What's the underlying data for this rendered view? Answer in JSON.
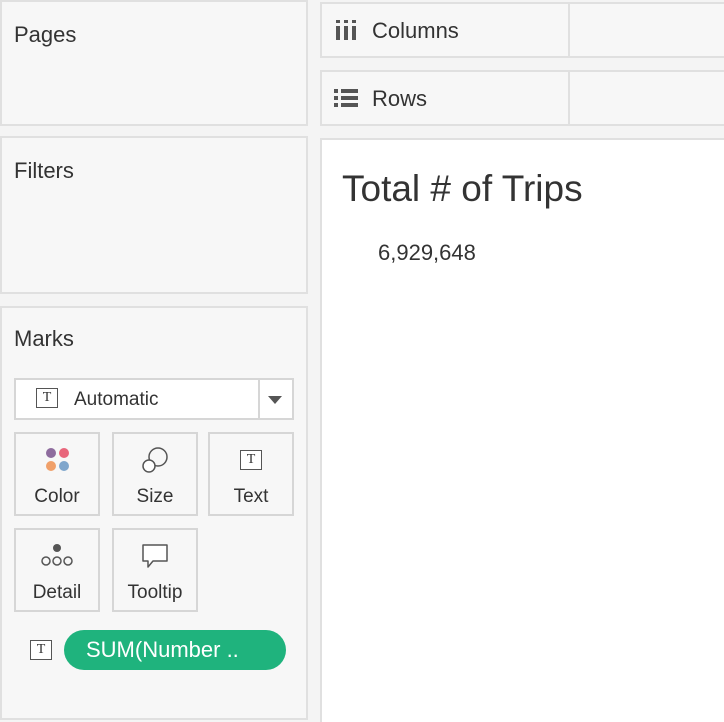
{
  "cards": {
    "pages": {
      "title": "Pages"
    },
    "filters": {
      "title": "Filters"
    },
    "marks": {
      "title": "Marks",
      "mark_type": "Automatic",
      "buttons": {
        "color": "Color",
        "size": "Size",
        "text": "Text",
        "detail": "Detail",
        "tooltip": "Tooltip"
      },
      "pill": {
        "label": "SUM(Number ..",
        "color": "#1fb37d"
      }
    }
  },
  "shelves": {
    "columns": {
      "label": "Columns",
      "icon": "columns-icon"
    },
    "rows": {
      "label": "Rows",
      "icon": "rows-icon"
    }
  },
  "view": {
    "title": "Total # of Trips",
    "value": "6,929,648"
  },
  "icons": {
    "text_glyph": "T"
  },
  "colors": {
    "pill": "#1fb37d",
    "color_dots": [
      "#8e6c9e",
      "#e8667b",
      "#f0a06a",
      "#7fa6cc"
    ]
  }
}
